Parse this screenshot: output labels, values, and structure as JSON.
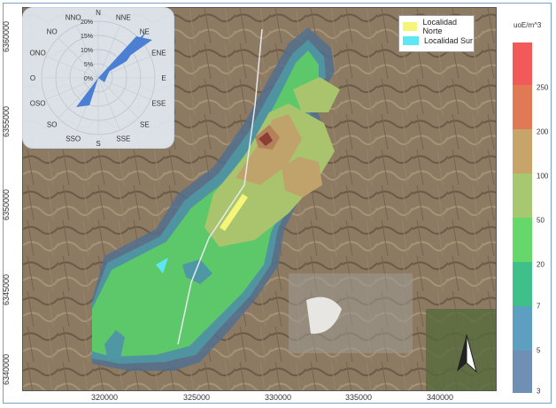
{
  "map": {
    "x_ticks": [
      "320000",
      "325000",
      "330000",
      "335000",
      "340000"
    ],
    "y_ticks": [
      "6360000",
      "6355000",
      "6350000",
      "6345000",
      "6340000"
    ]
  },
  "legend": {
    "items": [
      {
        "label": "Localidad Norte",
        "color": "#f5f57a"
      },
      {
        "label": "Localidad Sur",
        "color": "#5de6f4"
      }
    ]
  },
  "colorbar": {
    "unit": "uoE/m^3",
    "levels": [
      "250",
      "200",
      "100",
      "50",
      "20",
      "7",
      "5",
      "3"
    ],
    "colors": [
      "#f25a5a",
      "#e07a55",
      "#c7a46a",
      "#a7c870",
      "#66d86a",
      "#3fbf8a",
      "#5c9fc0",
      "#6f8fb4"
    ]
  },
  "windrose": {
    "directions": [
      "N",
      "NNE",
      "NE",
      "ENE",
      "E",
      "ESE",
      "SE",
      "SSE",
      "S",
      "SSO",
      "SO",
      "OSO",
      "O",
      "ONO",
      "NO",
      "NNO"
    ],
    "ring_labels": [
      "20%",
      "15%",
      "10%",
      "5%",
      "0%"
    ],
    "petal_color": "#4a7fd4"
  },
  "north_arrow": "north-arrow"
}
